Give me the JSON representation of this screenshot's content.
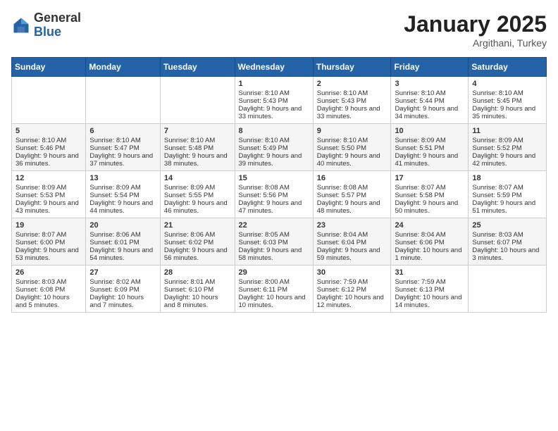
{
  "header": {
    "logo_general": "General",
    "logo_blue": "Blue",
    "title": "January 2025",
    "subtitle": "Argithani, Turkey"
  },
  "days_of_week": [
    "Sunday",
    "Monday",
    "Tuesday",
    "Wednesday",
    "Thursday",
    "Friday",
    "Saturday"
  ],
  "weeks": [
    [
      {
        "day": "",
        "content": ""
      },
      {
        "day": "",
        "content": ""
      },
      {
        "day": "",
        "content": ""
      },
      {
        "day": "1",
        "content": "Sunrise: 8:10 AM\nSunset: 5:43 PM\nDaylight: 9 hours and 33 minutes."
      },
      {
        "day": "2",
        "content": "Sunrise: 8:10 AM\nSunset: 5:43 PM\nDaylight: 9 hours and 33 minutes."
      },
      {
        "day": "3",
        "content": "Sunrise: 8:10 AM\nSunset: 5:44 PM\nDaylight: 9 hours and 34 minutes."
      },
      {
        "day": "4",
        "content": "Sunrise: 8:10 AM\nSunset: 5:45 PM\nDaylight: 9 hours and 35 minutes."
      }
    ],
    [
      {
        "day": "5",
        "content": "Sunrise: 8:10 AM\nSunset: 5:46 PM\nDaylight: 9 hours and 36 minutes."
      },
      {
        "day": "6",
        "content": "Sunrise: 8:10 AM\nSunset: 5:47 PM\nDaylight: 9 hours and 37 minutes."
      },
      {
        "day": "7",
        "content": "Sunrise: 8:10 AM\nSunset: 5:48 PM\nDaylight: 9 hours and 38 minutes."
      },
      {
        "day": "8",
        "content": "Sunrise: 8:10 AM\nSunset: 5:49 PM\nDaylight: 9 hours and 39 minutes."
      },
      {
        "day": "9",
        "content": "Sunrise: 8:10 AM\nSunset: 5:50 PM\nDaylight: 9 hours and 40 minutes."
      },
      {
        "day": "10",
        "content": "Sunrise: 8:09 AM\nSunset: 5:51 PM\nDaylight: 9 hours and 41 minutes."
      },
      {
        "day": "11",
        "content": "Sunrise: 8:09 AM\nSunset: 5:52 PM\nDaylight: 9 hours and 42 minutes."
      }
    ],
    [
      {
        "day": "12",
        "content": "Sunrise: 8:09 AM\nSunset: 5:53 PM\nDaylight: 9 hours and 43 minutes."
      },
      {
        "day": "13",
        "content": "Sunrise: 8:09 AM\nSunset: 5:54 PM\nDaylight: 9 hours and 44 minutes."
      },
      {
        "day": "14",
        "content": "Sunrise: 8:09 AM\nSunset: 5:55 PM\nDaylight: 9 hours and 46 minutes."
      },
      {
        "day": "15",
        "content": "Sunrise: 8:08 AM\nSunset: 5:56 PM\nDaylight: 9 hours and 47 minutes."
      },
      {
        "day": "16",
        "content": "Sunrise: 8:08 AM\nSunset: 5:57 PM\nDaylight: 9 hours and 48 minutes."
      },
      {
        "day": "17",
        "content": "Sunrise: 8:07 AM\nSunset: 5:58 PM\nDaylight: 9 hours and 50 minutes."
      },
      {
        "day": "18",
        "content": "Sunrise: 8:07 AM\nSunset: 5:59 PM\nDaylight: 9 hours and 51 minutes."
      }
    ],
    [
      {
        "day": "19",
        "content": "Sunrise: 8:07 AM\nSunset: 6:00 PM\nDaylight: 9 hours and 53 minutes."
      },
      {
        "day": "20",
        "content": "Sunrise: 8:06 AM\nSunset: 6:01 PM\nDaylight: 9 hours and 54 minutes."
      },
      {
        "day": "21",
        "content": "Sunrise: 8:06 AM\nSunset: 6:02 PM\nDaylight: 9 hours and 56 minutes."
      },
      {
        "day": "22",
        "content": "Sunrise: 8:05 AM\nSunset: 6:03 PM\nDaylight: 9 hours and 58 minutes."
      },
      {
        "day": "23",
        "content": "Sunrise: 8:04 AM\nSunset: 6:04 PM\nDaylight: 9 hours and 59 minutes."
      },
      {
        "day": "24",
        "content": "Sunrise: 8:04 AM\nSunset: 6:06 PM\nDaylight: 10 hours and 1 minute."
      },
      {
        "day": "25",
        "content": "Sunrise: 8:03 AM\nSunset: 6:07 PM\nDaylight: 10 hours and 3 minutes."
      }
    ],
    [
      {
        "day": "26",
        "content": "Sunrise: 8:03 AM\nSunset: 6:08 PM\nDaylight: 10 hours and 5 minutes."
      },
      {
        "day": "27",
        "content": "Sunrise: 8:02 AM\nSunset: 6:09 PM\nDaylight: 10 hours and 7 minutes."
      },
      {
        "day": "28",
        "content": "Sunrise: 8:01 AM\nSunset: 6:10 PM\nDaylight: 10 hours and 8 minutes."
      },
      {
        "day": "29",
        "content": "Sunrise: 8:00 AM\nSunset: 6:11 PM\nDaylight: 10 hours and 10 minutes."
      },
      {
        "day": "30",
        "content": "Sunrise: 7:59 AM\nSunset: 6:12 PM\nDaylight: 10 hours and 12 minutes."
      },
      {
        "day": "31",
        "content": "Sunrise: 7:59 AM\nSunset: 6:13 PM\nDaylight: 10 hours and 14 minutes."
      },
      {
        "day": "",
        "content": ""
      }
    ]
  ]
}
